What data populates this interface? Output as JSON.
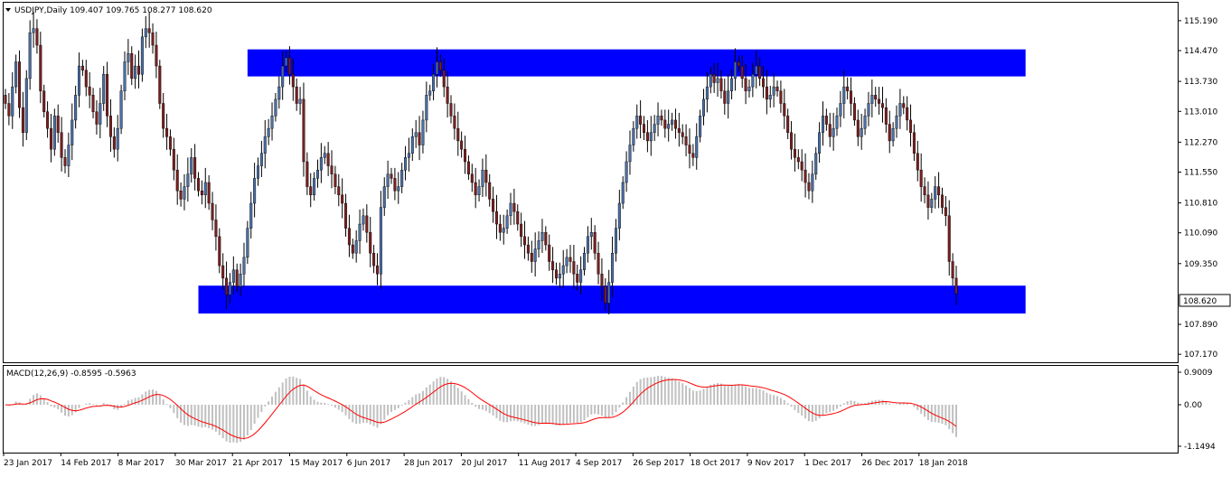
{
  "header": {
    "symbol_line": "USDJPY,Daily  109.407 109.765 108.277 108.620"
  },
  "macd_header": "MACD(12,26,9) -0.8595 -0.5963",
  "last_price_label": "108.620",
  "colors": {
    "zone": "#0000ff",
    "candle_fill": "#ffffff",
    "candle_outline": "#000000",
    "bull_candle": "#4a6fa5",
    "bear_candle": "#7a1f1f",
    "macd_hist": "#c0c0c0",
    "signal_line": "#ff0000",
    "last_price_bg": "#ffffff"
  },
  "chart_data": [
    {
      "type": "candlestick",
      "title": "USDJPY,Daily",
      "ylim": [
        107.0,
        115.6
      ],
      "price_ticks": [
        "115.190",
        "114.470",
        "113.730",
        "113.010",
        "112.270",
        "111.550",
        "110.810",
        "110.090",
        "109.350",
        "108.620",
        "107.890",
        "107.170"
      ],
      "x_ticks": [
        "23 Jan 2017",
        "14 Feb 2017",
        "8 Mar 2017",
        "30 Mar 2017",
        "21 Apr 2017",
        "15 May 2017",
        "6 Jun 2017",
        "28 Jun 2017",
        "20 Jul 2017",
        "11 Aug 2017",
        "4 Sep 2017",
        "26 Sep 2017",
        "18 Oct 2017",
        "9 Nov 2017",
        "1 Dec 2017",
        "26 Dec 2017",
        "18 Jan 2018"
      ],
      "zones": [
        {
          "from_index": 69,
          "to_index": 265,
          "low": 113.85,
          "high": 114.5
        },
        {
          "from_index": 55,
          "to_index": 265,
          "low": 108.15,
          "high": 108.82
        }
      ],
      "closes": [
        113.2,
        112.9,
        113.6,
        114.2,
        113.1,
        112.5,
        113.8,
        114.9,
        115.0,
        114.6,
        113.5,
        113.0,
        112.6,
        112.1,
        112.9,
        112.5,
        111.9,
        111.7,
        112.2,
        112.8,
        113.4,
        114.1,
        114.0,
        113.6,
        113.4,
        113.0,
        112.7,
        113.2,
        113.9,
        112.9,
        112.4,
        112.1,
        112.6,
        113.5,
        114.2,
        114.4,
        113.8,
        114.1,
        113.9,
        114.8,
        115.0,
        114.9,
        114.6,
        114.1,
        113.2,
        112.6,
        112.4,
        112.1,
        111.6,
        111.1,
        110.9,
        111.2,
        111.5,
        111.9,
        111.4,
        111.1,
        111.0,
        111.3,
        110.8,
        110.4,
        110.0,
        109.3,
        109.0,
        108.6,
        108.9,
        109.2,
        108.8,
        109.1,
        109.5,
        110.2,
        110.8,
        111.4,
        111.7,
        112.0,
        112.4,
        112.6,
        112.9,
        113.3,
        113.6,
        114.1,
        114.3,
        113.9,
        113.6,
        113.2,
        113.3,
        111.8,
        111.2,
        111.0,
        111.4,
        111.6,
        111.9,
        112.0,
        111.7,
        111.5,
        111.2,
        111.0,
        110.8,
        110.2,
        109.8,
        109.6,
        109.9,
        110.3,
        110.5,
        110.1,
        109.6,
        109.3,
        109.1,
        110.7,
        111.2,
        111.5,
        111.4,
        111.1,
        111.2,
        111.6,
        111.9,
        112.0,
        112.4,
        112.5,
        112.2,
        112.8,
        113.4,
        113.5,
        113.9,
        114.2,
        114.0,
        113.6,
        113.2,
        112.9,
        112.6,
        112.3,
        112.1,
        111.8,
        111.5,
        111.3,
        111.0,
        111.2,
        111.6,
        111.3,
        110.9,
        110.6,
        110.3,
        110.1,
        110.2,
        110.5,
        110.8,
        110.6,
        110.3,
        110.0,
        109.8,
        109.6,
        109.4,
        109.7,
        109.9,
        110.1,
        109.8,
        109.4,
        109.2,
        109.0,
        109.1,
        109.3,
        109.5,
        109.4,
        109.1,
        108.9,
        109.2,
        109.6,
        110.0,
        110.1,
        109.6,
        109.1,
        108.8,
        108.4,
        108.9,
        109.6,
        110.2,
        110.8,
        111.3,
        111.8,
        112.2,
        112.6,
        112.9,
        112.7,
        112.5,
        112.3,
        112.5,
        112.7,
        112.9,
        112.8,
        112.6,
        112.7,
        112.8,
        112.6,
        112.5,
        112.4,
        112.2,
        112.0,
        111.9,
        112.4,
        112.9,
        113.3,
        113.6,
        113.9,
        113.7,
        113.8,
        113.5,
        113.2,
        113.5,
        113.8,
        114.2,
        114.1,
        113.8,
        113.5,
        113.6,
        113.9,
        114.1,
        113.8,
        113.6,
        113.3,
        113.4,
        113.6,
        113.5,
        113.2,
        112.9,
        112.5,
        112.1,
        111.9,
        111.8,
        111.6,
        111.3,
        111.1,
        111.5,
        112.0,
        112.5,
        112.9,
        112.7,
        112.4,
        112.6,
        112.9,
        113.2,
        113.6,
        113.5,
        113.2,
        112.8,
        112.4,
        112.6,
        112.9,
        113.2,
        113.4,
        113.3,
        113.2,
        113.1,
        112.7,
        112.3,
        112.6,
        112.9,
        113.2,
        113.1,
        112.8,
        112.5,
        112.0,
        111.6,
        111.2,
        111.0,
        110.7,
        110.9,
        111.2,
        111.0,
        110.7,
        110.5,
        109.4,
        109.0,
        108.62
      ],
      "macd": {
        "label": "MACD(12,26,9)",
        "main_value": -0.8595,
        "signal_value": -0.5963,
        "ticks": [
          "0.9009",
          "0.00",
          "-1.1494"
        ],
        "ylim": [
          -1.3,
          1.05
        ]
      }
    }
  ]
}
